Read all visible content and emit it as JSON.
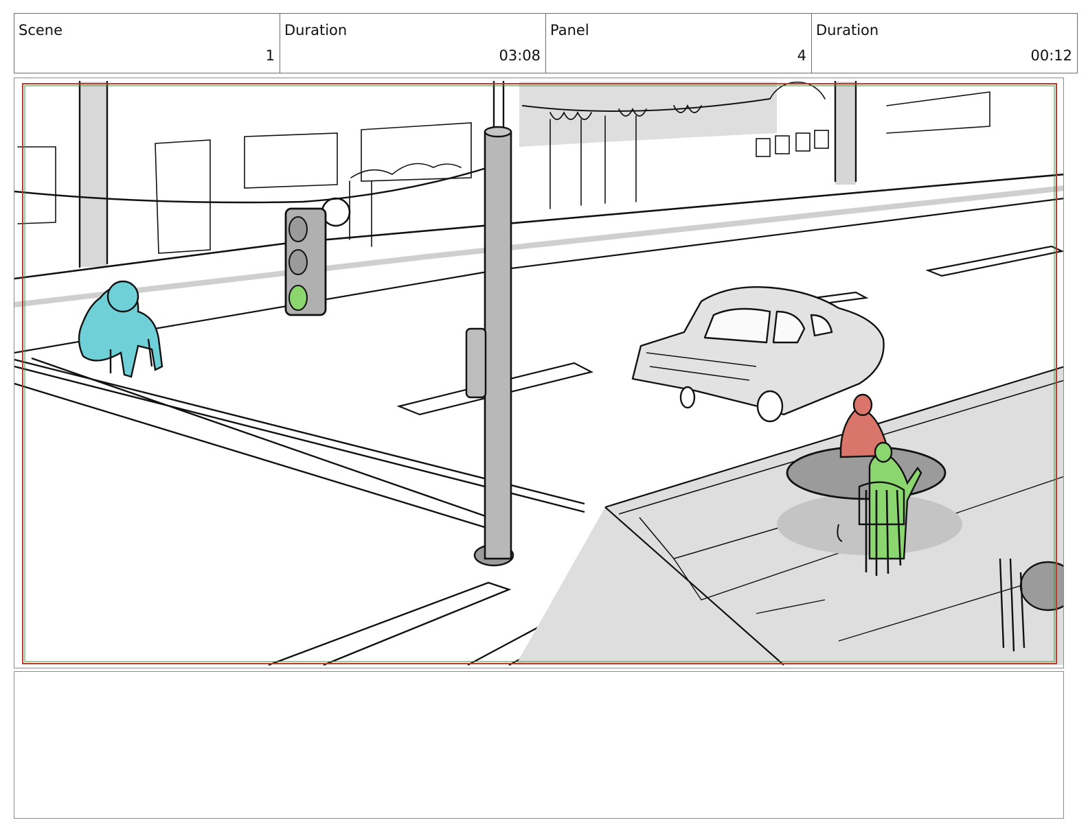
{
  "header": {
    "cells": [
      {
        "label": "Scene",
        "value": "1"
      },
      {
        "label": "Duration",
        "value": "03:08"
      },
      {
        "label": "Panel",
        "value": "4"
      },
      {
        "label": "Duration",
        "value": "00:12"
      }
    ]
  },
  "notes": {
    "text": ""
  },
  "colors": {
    "walker_figure": "#6fd0d8",
    "seated_red_figure": "#d9756a",
    "seated_green_figure": "#8cd66f",
    "traffic_light_green": "#8cd66f",
    "safe_area_outer": "#c0392b",
    "safe_area_inner": "#3a9a3a"
  }
}
